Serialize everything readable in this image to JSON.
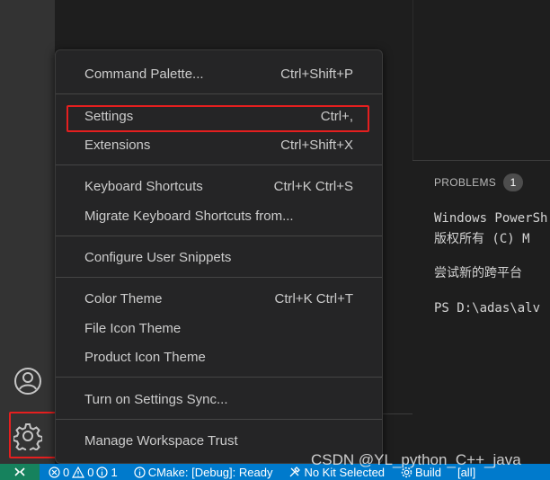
{
  "menu": {
    "items": [
      {
        "label": "Command Palette...",
        "shortcut": "Ctrl+Shift+P"
      },
      {
        "label": "Settings",
        "shortcut": "Ctrl+,"
      },
      {
        "label": "Extensions",
        "shortcut": "Ctrl+Shift+X"
      },
      {
        "label": "Keyboard Shortcuts",
        "shortcut": "Ctrl+K Ctrl+S"
      },
      {
        "label": "Migrate Keyboard Shortcuts from...",
        "shortcut": ""
      },
      {
        "label": "Configure User Snippets",
        "shortcut": ""
      },
      {
        "label": "Color Theme",
        "shortcut": "Ctrl+K Ctrl+T"
      },
      {
        "label": "File Icon Theme",
        "shortcut": ""
      },
      {
        "label": "Product Icon Theme",
        "shortcut": ""
      },
      {
        "label": "Turn on Settings Sync...",
        "shortcut": ""
      },
      {
        "label": "Manage Workspace Trust",
        "shortcut": ""
      }
    ]
  },
  "panel": {
    "tab_label": "PROBLEMS",
    "problem_count": "1",
    "terminal_lines": [
      "Windows PowerSh",
      "版权所有 (C) M",
      "尝试新的跨平台",
      "PS D:\\adas\\alv"
    ]
  },
  "status_bar": {
    "errors": "0",
    "warnings": "0",
    "info": "1",
    "cmake": "CMake: [Debug]: Ready",
    "kit": "No Kit Selected",
    "build": "Build",
    "target": "[all]"
  },
  "watermark": "CSDN @YL_python_C++_java",
  "colors": {
    "accent": "#007acc",
    "highlight": "#e51f1f",
    "remote": "#16825d"
  }
}
